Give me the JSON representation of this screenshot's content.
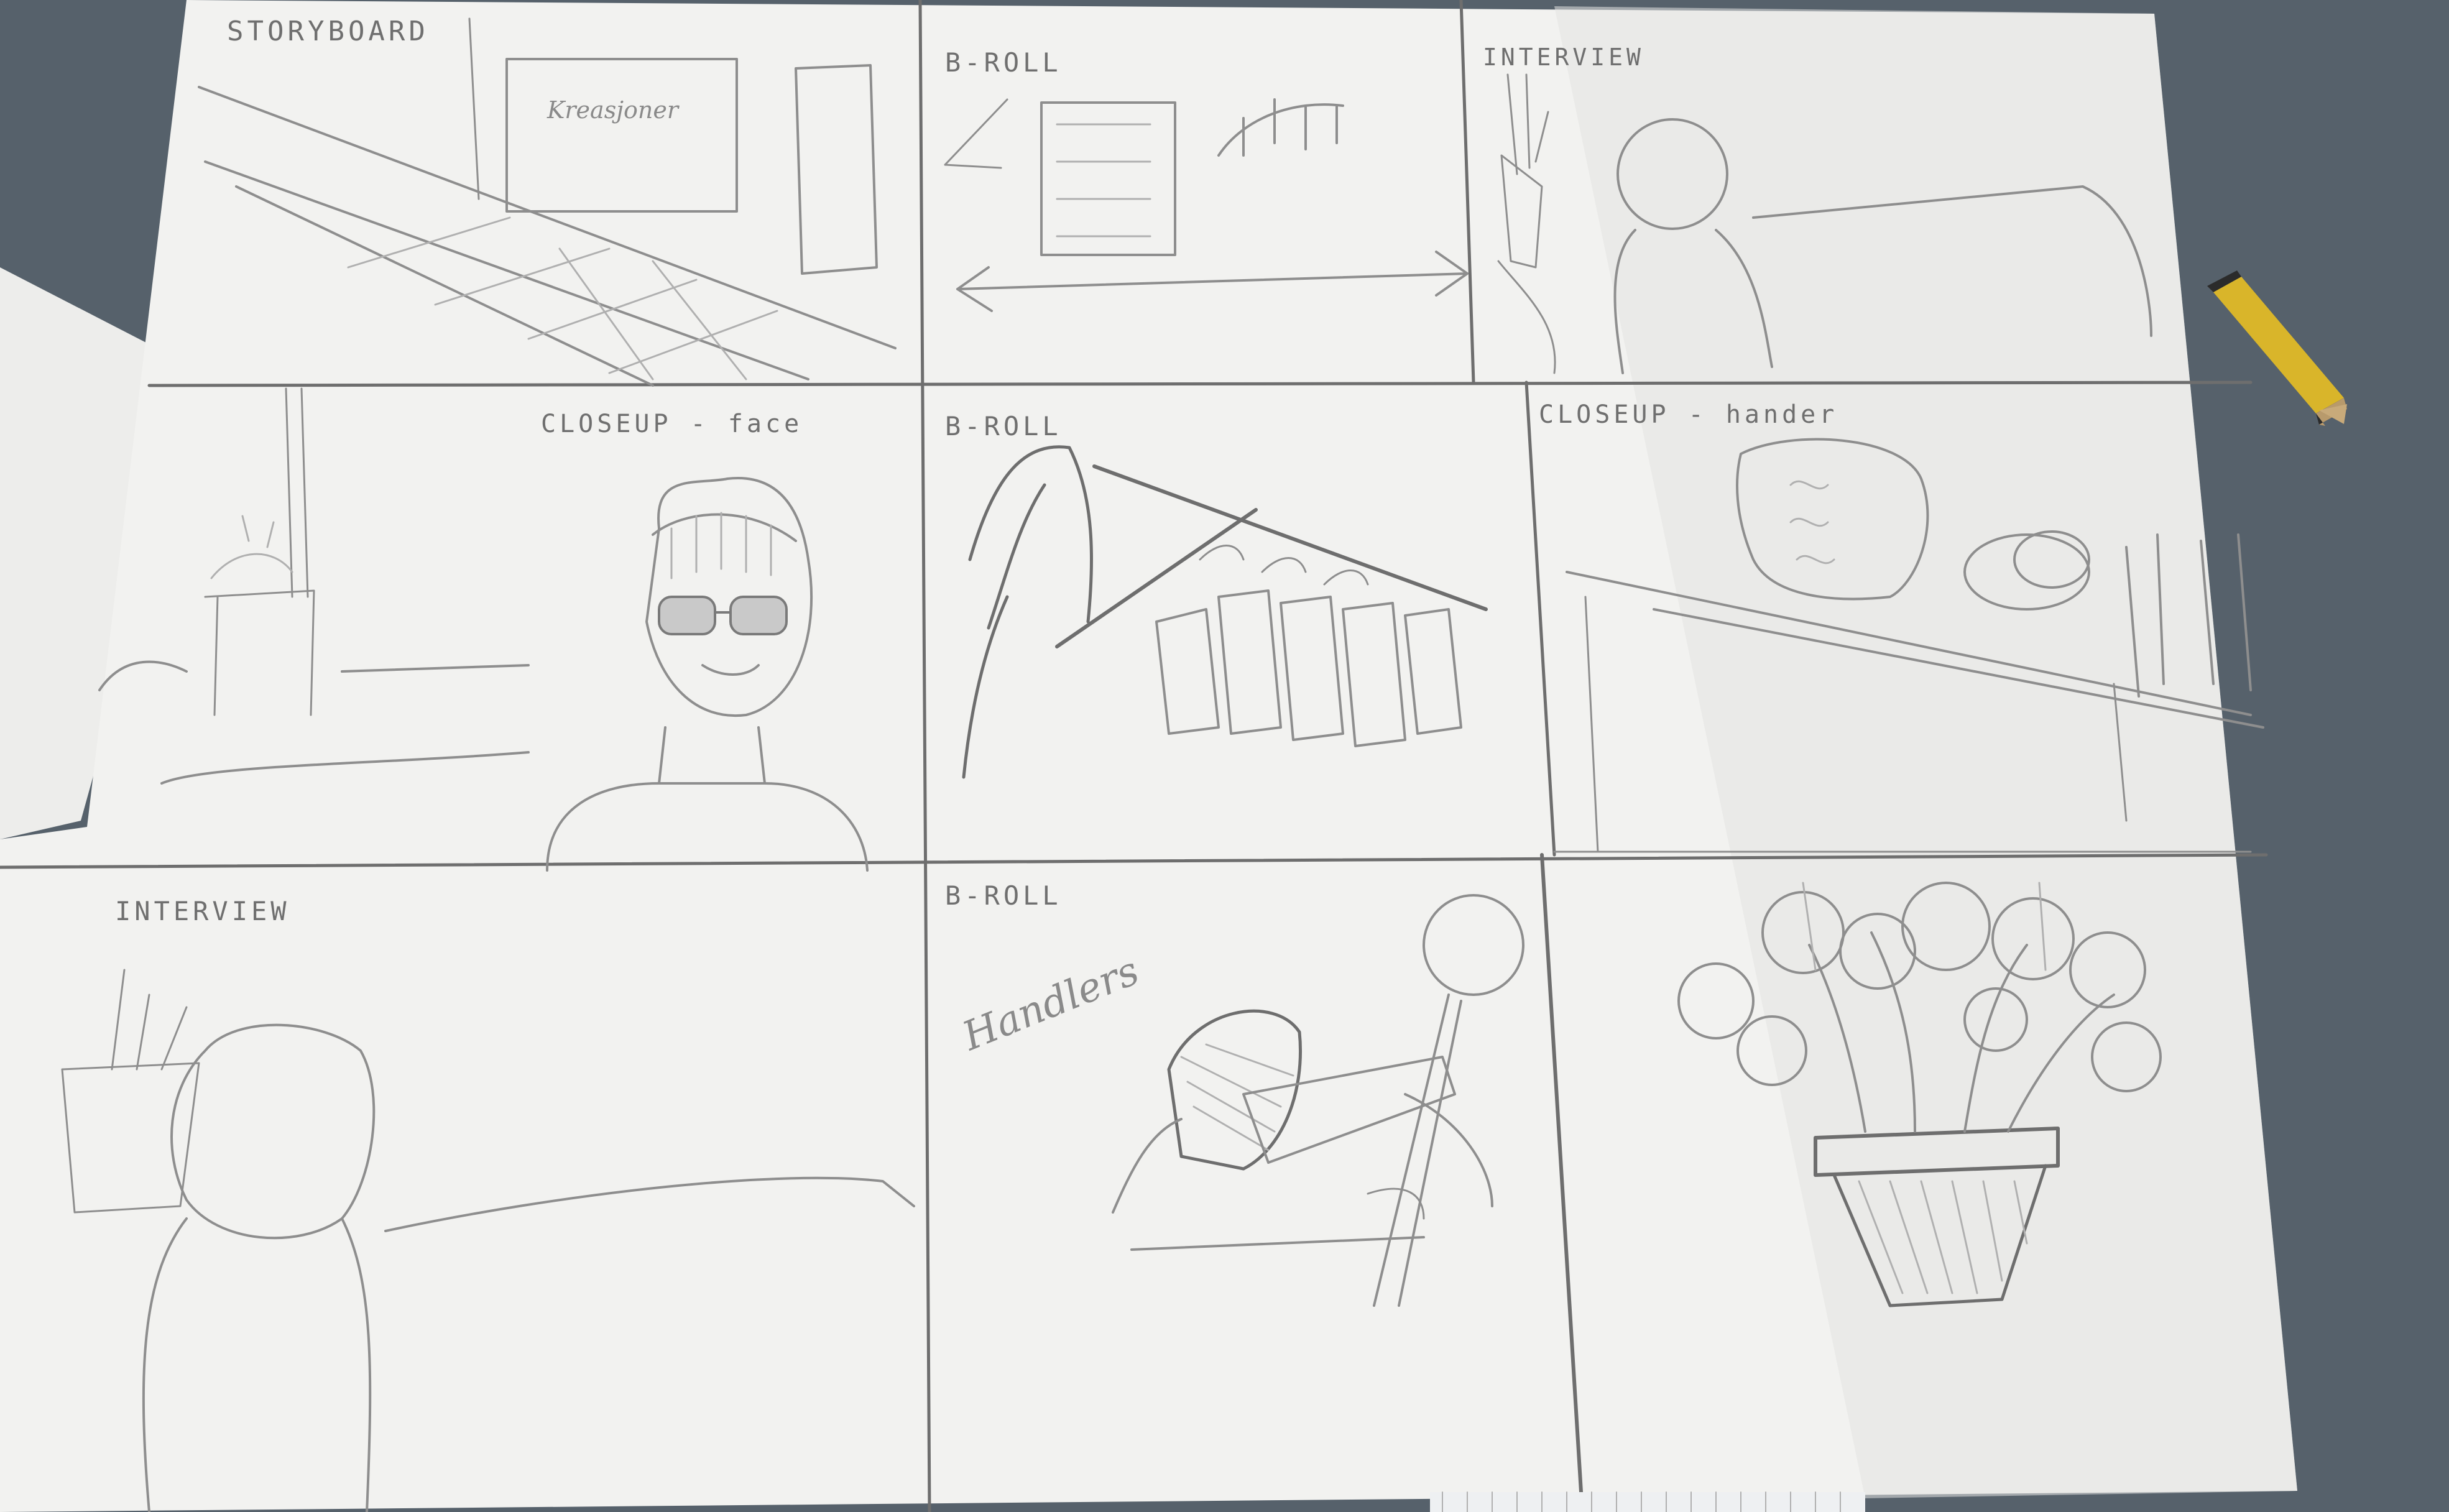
{
  "storyboard": {
    "title": "STORYBOARD",
    "panels": [
      {
        "label": "STORYBOARD",
        "note": "Kreasjoner"
      },
      {
        "label": "B-ROLL"
      },
      {
        "label": "INTERVIEW"
      },
      {
        "label": "CLOSEUP - face"
      },
      {
        "label": "B-ROLL"
      },
      {
        "label": "CLOSEUP - hander"
      },
      {
        "label": "INTERVIEW"
      },
      {
        "label": "B-ROLL",
        "note": "Handlers"
      },
      {
        "label": ""
      }
    ]
  },
  "colors": {
    "desk": "#5b6670",
    "paper": "#f2f2f0",
    "pencil": "#8e8e8e",
    "pencil_body": "#d9b52a"
  },
  "icons": {
    "pencil": "pencil-icon",
    "sunglasses": "sunglasses-icon",
    "flower_pot": "flower-pot-icon",
    "clothes_rack": "clothes-rack-icon"
  }
}
